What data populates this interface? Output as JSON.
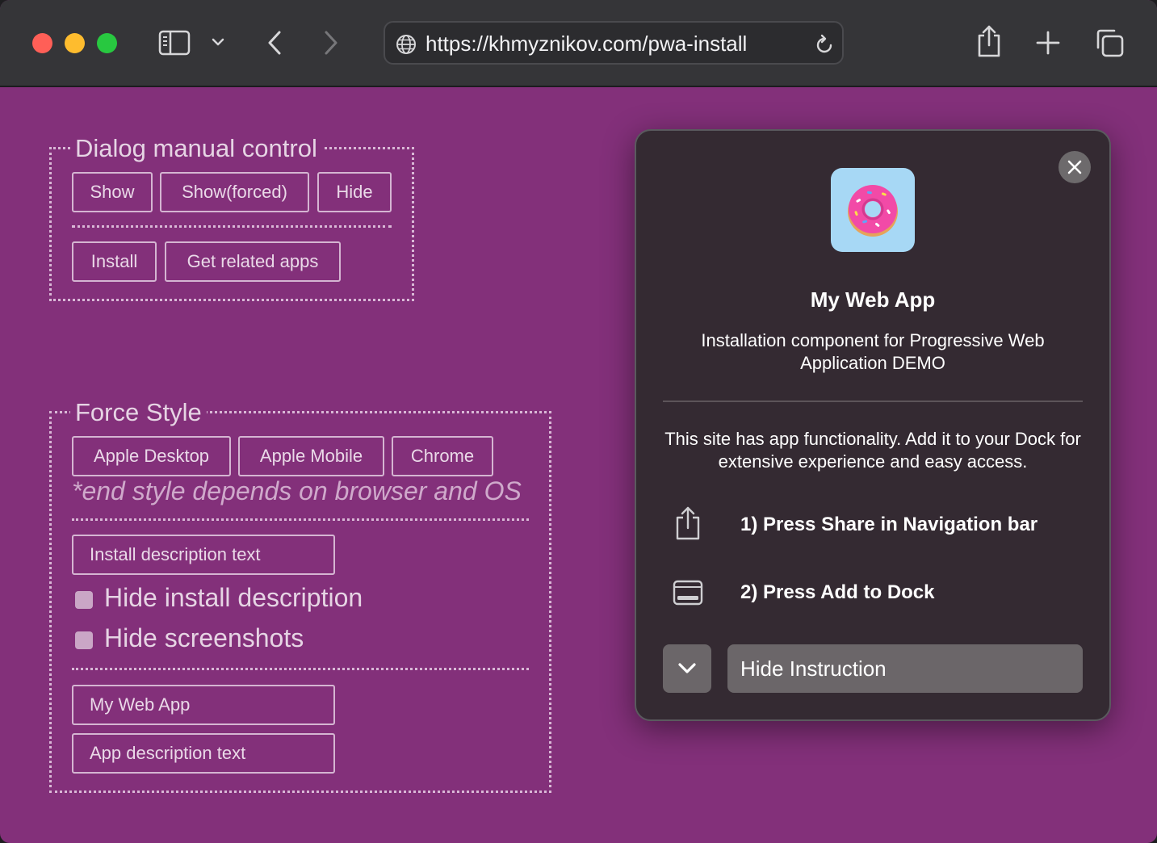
{
  "browser": {
    "url": "https://khmyznikov.com/pwa-install",
    "icons": [
      "sidebar-icon",
      "chevron-down-icon",
      "back-icon",
      "forward-icon",
      "globe-icon",
      "reload-icon",
      "share-icon",
      "plus-icon",
      "tabs-icon"
    ]
  },
  "dialog_control": {
    "legend": "Dialog manual control",
    "show": "Show",
    "show_forced": "Show(forced)",
    "hide": "Hide",
    "install": "Install",
    "get_related_apps": "Get related apps"
  },
  "force_style": {
    "legend": "Force Style",
    "apple_desktop": "Apple Desktop",
    "apple_mobile": "Apple Mobile",
    "chrome": "Chrome",
    "note": "*end style depends on browser and OS",
    "install_description_value": "Install description text",
    "hide_install_description": "Hide install description",
    "hide_screenshots": "Hide screenshots",
    "app_name_value": "My Web App",
    "app_description_value": "App description text"
  },
  "install_dialog": {
    "app_name": "My Web App",
    "app_description": "Installation component for Progressive Web Application DEMO",
    "info": "This site has app functionality. Add it to your Dock for extensive experience and easy access.",
    "step1": "1) Press Share in Navigation bar",
    "step2": "2) Press Add to Dock",
    "hide_instruction": "Hide Instruction"
  },
  "colors": {
    "page_background": "#83307a",
    "toolbar": "#353538",
    "dialog_background": "#342a32"
  }
}
